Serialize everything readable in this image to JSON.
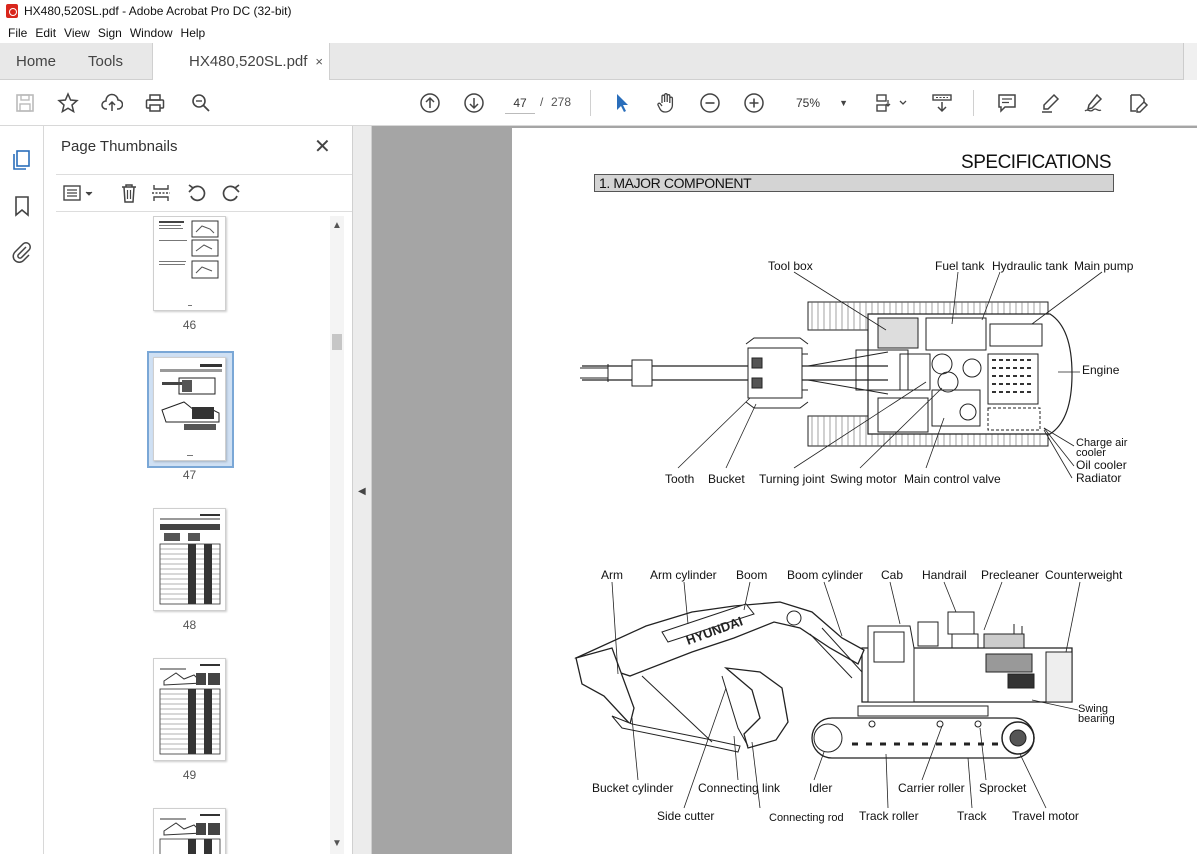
{
  "window": {
    "title": "HX480,520SL.pdf - Adobe Acrobat Pro DC (32-bit)"
  },
  "menu": [
    "File",
    "Edit",
    "View",
    "Sign",
    "Window",
    "Help"
  ],
  "tabs": {
    "home": "Home",
    "tools": "Tools",
    "document": "HX480,520SL.pdf",
    "close": "×"
  },
  "toolbar": {
    "page_current": "47",
    "page_separator": "/",
    "page_total": "278",
    "zoom": "75%"
  },
  "panel": {
    "title": "Page Thumbnails",
    "thumbnails": [
      {
        "label": "46"
      },
      {
        "label": "47",
        "selected": true
      },
      {
        "label": "48"
      },
      {
        "label": "49"
      }
    ]
  },
  "document": {
    "heading": "SPECIFICATIONS",
    "section": "1. MAJOR COMPONENT",
    "top_view_labels": {
      "tool_box": "Tool box",
      "fuel_tank": "Fuel tank",
      "hydraulic_tank": "Hydraulic tank",
      "main_pump": "Main pump",
      "engine": "Engine",
      "charge_air_cooler_1": "Charge air",
      "charge_air_cooler_2": "cooler",
      "oil_cooler": "Oil cooler",
      "radiator": "Radiator",
      "tooth": "Tooth",
      "bucket": "Bucket",
      "turning_joint": "Turning joint",
      "swing_motor": "Swing motor",
      "main_control_valve": "Main control valve"
    },
    "side_view_labels": {
      "arm": "Arm",
      "arm_cylinder": "Arm cylinder",
      "boom": "Boom",
      "boom_cylinder": "Boom cylinder",
      "cab": "Cab",
      "handrail": "Handrail",
      "precleaner": "Precleaner",
      "counterweight": "Counterweight",
      "swing_bearing_1": "Swing",
      "swing_bearing_2": "bearing",
      "bucket_cylinder": "Bucket cylinder",
      "connecting_link": "Connecting link",
      "idler": "Idler",
      "carrier_roller": "Carrier roller",
      "sprocket": "Sprocket",
      "side_cutter": "Side cutter",
      "connecting_rod": "Connecting rod",
      "track_roller": "Track roller",
      "track": "Track",
      "travel_motor": "Travel motor",
      "brand": "HYUNDAI"
    }
  }
}
